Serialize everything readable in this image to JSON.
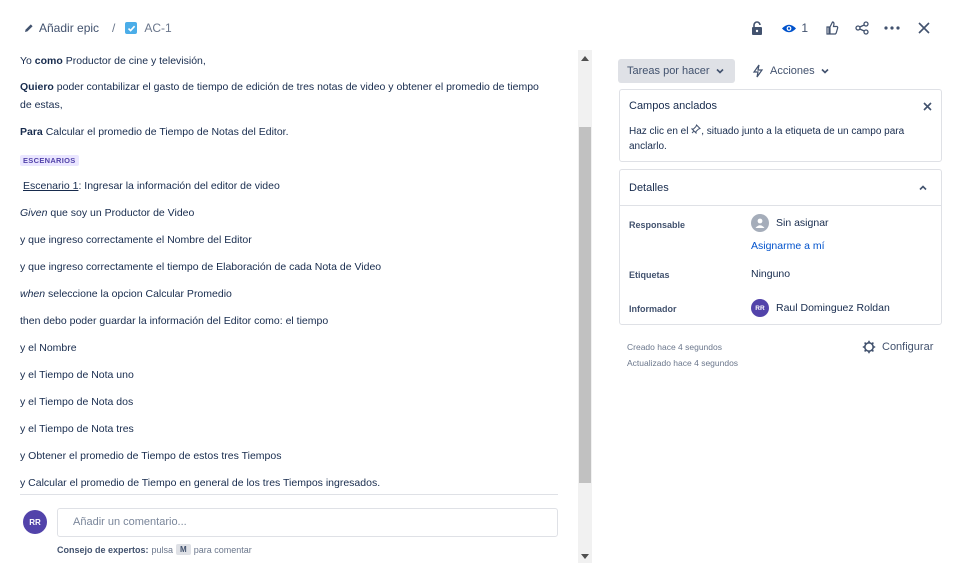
{
  "header": {
    "add_epic": "Añadir epic",
    "separator": "/",
    "issue_key": "AC-1",
    "watch_count": "1"
  },
  "description": {
    "lines": [
      {
        "pre": "Yo ",
        "bold": "como",
        "post": " Productor de cine y televisión,"
      },
      {
        "pre": "",
        "bold": "Quiero",
        "post": " poder contabilizar el gasto de tiempo de edición de tres notas de video y obtener el promedio de tiempo"
      },
      {
        "pre": "de estas,",
        "bold": "",
        "post": ""
      },
      {
        "pre": "",
        "bold": "Para",
        "post": " Calcular el promedio de Tiempo de Notas del Editor."
      }
    ],
    "badge": "ESCENARIOS",
    "scenario_link": "Escenario 1",
    "scenario_rest": ": Ingresar la información del editor de video",
    "given_word": "Given",
    "given_rest": " que soy un Productor de Video",
    "l1": "y que ingreso correctamente el Nombre del Editor",
    "l2": "y que ingreso correctamente el tiempo de Elaboración de cada Nota de Video",
    "when_word": "when",
    "when_rest": " seleccione la opcion Calcular Promedio",
    "l3": "then debo poder guardar la información del Editor como: el tiempo",
    "l4": "y el Nombre",
    "l5": "y el Tiempo de Nota uno",
    "l6": "y el Tiempo de Nota dos",
    "l7": "y el Tiempo de Nota tres",
    "l8": "y Obtener el promedio de Tiempo de estos tres Tiempos",
    "l9": "y Calcular el promedio de Tiempo en general de los tres Tiempos ingresados."
  },
  "comment": {
    "avatar": "RR",
    "placeholder": "Añadir un comentario...",
    "tip_bold": "Consejo de expertos:",
    "tip_mid": "pulsa",
    "tip_key": "M",
    "tip_end": "para comentar"
  },
  "sidebar": {
    "status": "Tareas por hacer",
    "actions": "Acciones",
    "pinned_title": "Campos anclados",
    "pinned_text_a": "Haz clic en el",
    "pinned_text_b": ", situado junto a la etiqueta de un campo para anclarlo.",
    "details_title": "Detalles",
    "assignee_label": "Responsable",
    "assignee_value": "Sin asignar",
    "assign_me": "Asignarme a mí",
    "labels_label": "Etiquetas",
    "labels_value": "Ninguno",
    "reporter_label": "Informador",
    "reporter_avatar": "RR",
    "reporter_value": "Raul Dominguez Roldan",
    "created": "Creado hace 4 segundos",
    "updated": "Actualizado hace 4 segundos",
    "configure": "Configurar"
  }
}
